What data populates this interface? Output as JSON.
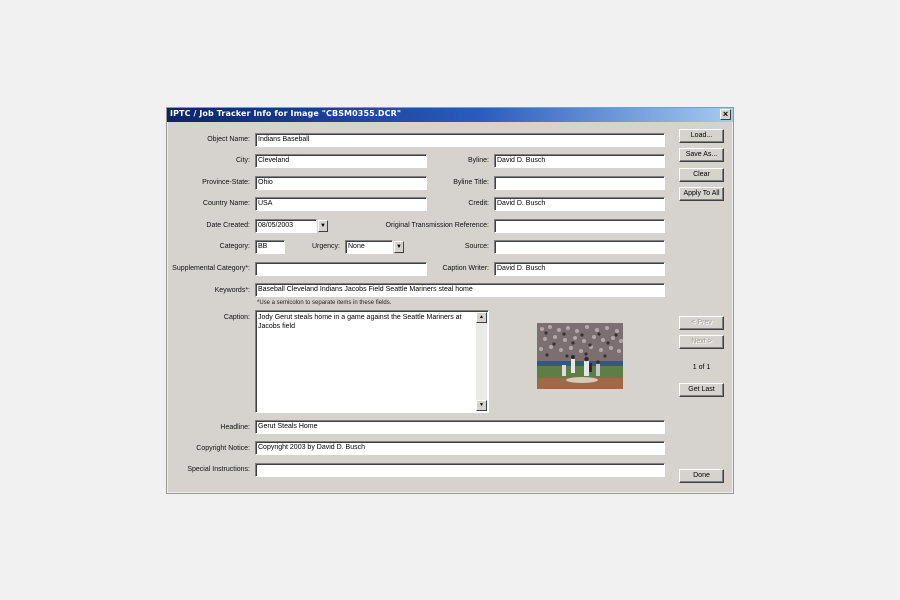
{
  "window": {
    "title": "IPTC / Job Tracker Info for Image \"CBSM0355.DCR\"",
    "close_glyph": "×"
  },
  "labels": {
    "object_name": "Object Name:",
    "city": "City:",
    "byline": "Byline:",
    "province_state": "Province-State:",
    "byline_title": "Byline Title:",
    "country_name": "Country Name:",
    "credit": "Credit:",
    "date_created": "Date Created:",
    "original_transmission_reference": "Original Transmission Reference:",
    "category": "Category:",
    "urgency": "Urgency:",
    "source": "Source:",
    "supplemental_category": "Supplemental Category*:",
    "caption_writer": "Caption Writer:",
    "keywords": "Keywords*:",
    "caption": "Caption:",
    "headline": "Headline:",
    "copyright_notice": "Copyright Notice:",
    "special_instructions": "Special Instructions:"
  },
  "fields": {
    "object_name": "Indians Baseball",
    "city": "Cleveland",
    "byline": "David D. Busch",
    "province_state": "Ohio",
    "byline_title": "",
    "country_name": "USA",
    "credit": "David D. Busch",
    "date_created": "08/05/2003",
    "original_transmission_reference": "",
    "category": "BB",
    "urgency": "None",
    "source": "",
    "supplemental_category": "",
    "caption_writer": "David D. Busch",
    "keywords": "Baseball Cleveland Indians Jacobs Field Seattle Mariners steal home",
    "caption": "Jody Gerut steals home in a game against the Seattle Mariners at Jacobs field",
    "headline": "Gerut Steals Home",
    "copyright_notice": "Copyright 2003 by David D. Busch",
    "special_instructions": ""
  },
  "note": "*Use a semicolon to separate items in these fields.",
  "buttons": {
    "load": "Load...",
    "save_as": "Save As...",
    "clear": "Clear",
    "apply_to_all": "Apply To All",
    "prev": "< Prev",
    "next": "Next >",
    "get_last": "Get Last",
    "done": "Done"
  },
  "navigation": {
    "position": "1 of 1"
  },
  "icons": {
    "dropdown": "▼",
    "scroll_up": "▲",
    "scroll_down": "▼"
  },
  "colors": {
    "dialog_bg": "#d6d3ce",
    "title_bar": "#0a246a"
  }
}
